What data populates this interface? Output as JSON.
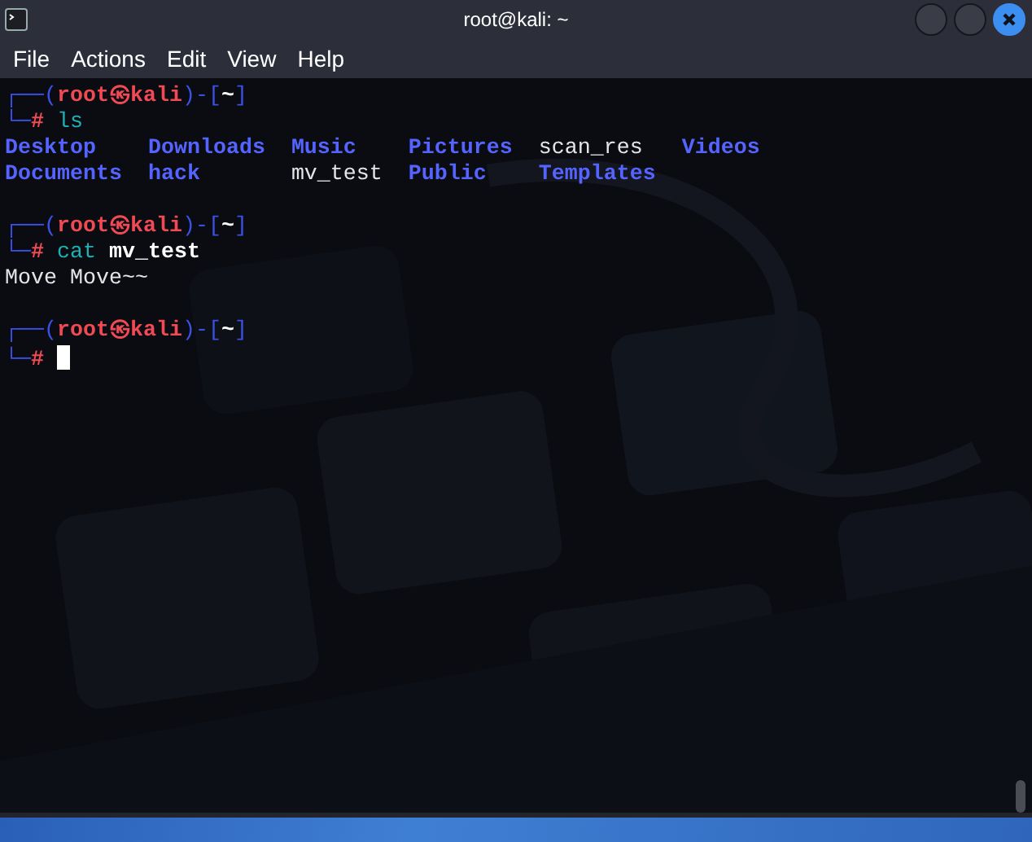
{
  "window": {
    "title": "root@kali: ~"
  },
  "menu": [
    "File",
    "Actions",
    "Edit",
    "View",
    "Help"
  ],
  "blocks": [
    {
      "prompt": {
        "open": "┌──(",
        "user": "root",
        "mark": "㉿",
        "host": "kali",
        "sep": ")-[",
        "dir": "~",
        "close": "]",
        "corner": "└─",
        "symbol": "#"
      },
      "command": [
        {
          "text": "ls",
          "kind": "command"
        }
      ],
      "output": {
        "kind": "listing",
        "columns": [
          [
            {
              "name": "Desktop",
              "kind": "dir"
            },
            {
              "name": "Documents",
              "kind": "dir"
            }
          ],
          [
            {
              "name": "Downloads",
              "kind": "dir"
            },
            {
              "name": "hack",
              "kind": "dir"
            }
          ],
          [
            {
              "name": "Music",
              "kind": "dir"
            },
            {
              "name": "mv_test",
              "kind": "file"
            }
          ],
          [
            {
              "name": "Pictures",
              "kind": "dir"
            },
            {
              "name": "Public",
              "kind": "dir"
            }
          ],
          [
            {
              "name": "scan_res",
              "kind": "file"
            },
            {
              "name": "Templates",
              "kind": "dir"
            }
          ],
          [
            {
              "name": "Videos",
              "kind": "dir"
            }
          ]
        ]
      }
    },
    {
      "prompt": {
        "open": "┌──(",
        "user": "root",
        "mark": "㉿",
        "host": "kali",
        "sep": ")-[",
        "dir": "~",
        "close": "]",
        "corner": "└─",
        "symbol": "#"
      },
      "command": [
        {
          "text": "cat",
          "kind": "command"
        },
        {
          "text": "mv_test",
          "kind": "argument"
        }
      ],
      "output": {
        "kind": "text",
        "lines": [
          "Move Move~~"
        ]
      }
    },
    {
      "prompt": {
        "open": "┌──(",
        "user": "root",
        "mark": "㉿",
        "host": "kali",
        "sep": ")-[",
        "dir": "~",
        "close": "]",
        "corner": "└─",
        "symbol": "#"
      },
      "cursor": true
    }
  ]
}
